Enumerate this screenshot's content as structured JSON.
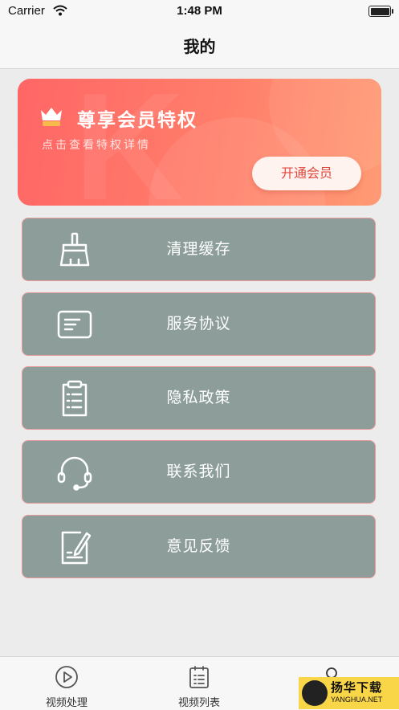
{
  "status_bar": {
    "carrier": "Carrier",
    "time": "1:48 PM"
  },
  "nav": {
    "title": "我的"
  },
  "vip_card": {
    "title": "尊享会员特权",
    "subtitle": "点击查看特权详情",
    "button": "开通会员",
    "accent_start": "#ff6666",
    "accent_end": "#ff9b74"
  },
  "menu": [
    {
      "label": "清理缓存",
      "icon": "broom-icon"
    },
    {
      "label": "服务协议",
      "icon": "card-icon"
    },
    {
      "label": "隐私政策",
      "icon": "clipboard-icon"
    },
    {
      "label": "联系我们",
      "icon": "headset-icon"
    },
    {
      "label": "意见反馈",
      "icon": "edit-note-icon"
    }
  ],
  "menu_colors": {
    "background": "#8d9e9a",
    "border": "#e89a9a"
  },
  "tabs": [
    {
      "label": "视频处理",
      "icon": "play-circle-icon"
    },
    {
      "label": "视频列表",
      "icon": "list-icon"
    },
    {
      "label": "",
      "icon": "profile-icon"
    }
  ],
  "watermark": {
    "line1": "扬华下载",
    "line2": "YANGHUA.NET"
  }
}
